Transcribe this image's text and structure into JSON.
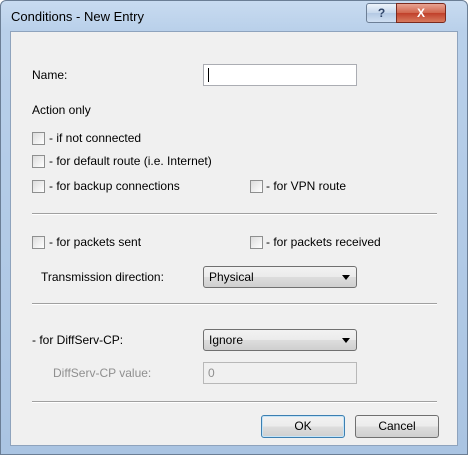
{
  "window": {
    "title": "Conditions - New Entry",
    "help_icon": "?",
    "close_icon": "X"
  },
  "form": {
    "name_label": "Name:",
    "name_value": "",
    "action_only_label": "Action only",
    "if_not_connected_label": "- if not connected",
    "if_not_connected_checked": false,
    "default_route_label": "- for default route (i.e. Internet)",
    "default_route_checked": false,
    "backup_connections_label": "- for backup connections",
    "backup_connections_checked": false,
    "vpn_route_label": "- for VPN route",
    "vpn_route_checked": false,
    "packets_sent_label": "- for packets sent",
    "packets_sent_checked": false,
    "packets_received_label": "- for packets received",
    "packets_received_checked": false,
    "transmission_direction_label": "Transmission direction:",
    "transmission_direction_value": "Physical",
    "diffserv_label": "- for DiffServ-CP:",
    "diffserv_value": "Ignore",
    "diffserv_value_label": "DiffServ-CP value:",
    "diffserv_value_field": "0"
  },
  "buttons": {
    "ok": "OK",
    "cancel": "Cancel"
  }
}
